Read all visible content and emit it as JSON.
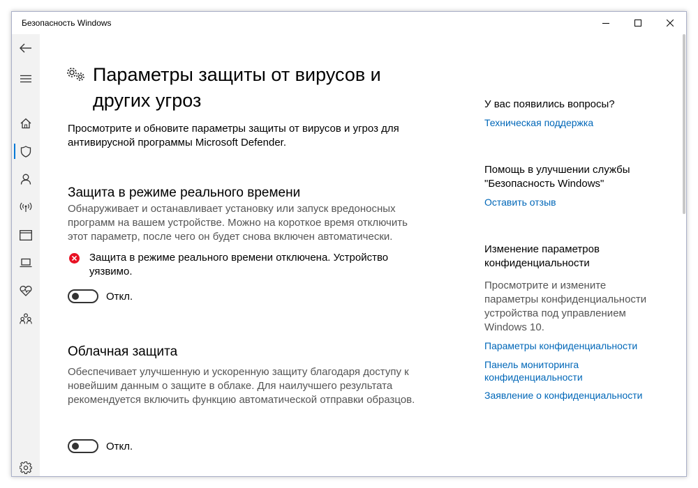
{
  "window": {
    "title": "Безопасность Windows",
    "controls": [
      "minimize-icon",
      "maximize-icon",
      "close-icon"
    ]
  },
  "sidebar": {
    "items": [
      {
        "name": "back",
        "icon": "back-arrow-icon"
      },
      {
        "name": "menu",
        "icon": "hamburger-icon"
      },
      {
        "name": "home",
        "icon": "home-icon"
      },
      {
        "name": "virus-protection",
        "icon": "shield-icon",
        "active": true
      },
      {
        "name": "account",
        "icon": "person-icon"
      },
      {
        "name": "firewall",
        "icon": "wireless-icon"
      },
      {
        "name": "app-browser",
        "icon": "browser-window-icon"
      },
      {
        "name": "device-security",
        "icon": "laptop-icon"
      },
      {
        "name": "device-health",
        "icon": "heart-pulse-icon"
      },
      {
        "name": "family",
        "icon": "family-icon"
      },
      {
        "name": "settings",
        "icon": "gear-icon"
      }
    ]
  },
  "main": {
    "title": "Параметры защиты от вирусов и других угроз",
    "title_icon": "gears-icon",
    "description": "Просмотрите и обновите параметры защиты от вирусов и угроз для антивирусной программы Microsoft Defender.",
    "sections": [
      {
        "title": "Защита в режиме реального времени",
        "description": "Обнаруживает и останавливает установку или запуск вредоносных программ на вашем устройстве. Можно на короткое время отключить этот параметр, после чего он будет снова включен автоматически.",
        "warning": "Защита в режиме реального времени отключена. Устройство уязвимо.",
        "warning_icon": "error-x-icon",
        "toggle_state": "Откл."
      },
      {
        "title": "Облачная защита",
        "description": "Обеспечивает улучшенную и ускоренную защиту благодаря доступу к новейшим данным о защите в облаке. Для наилучшего результата рекомендуется включить функцию автоматической отправки образцов.",
        "toggle_state": "Откл."
      }
    ]
  },
  "right": {
    "questions_title": "У вас появились вопросы?",
    "support_link": "Техническая поддержка",
    "improve_title": "Помощь в улучшении службы \"Безопасность Windows\"",
    "feedback_link": "Оставить отзыв",
    "privacy_title": "Изменение параметров конфиденциальности",
    "privacy_text": "Просмотрите и измените параметры конфиденциальности устройства под управлением Windows 10.",
    "privacy_links": [
      "Параметры конфиденциальности",
      "Панель мониторинга конфиденциальности",
      "Заявление о конфиденциальности"
    ]
  },
  "colors": {
    "accent": "#0078d7",
    "link": "#0067b8",
    "error": "#e81123",
    "sidebar_bg": "#f2f2f2"
  }
}
